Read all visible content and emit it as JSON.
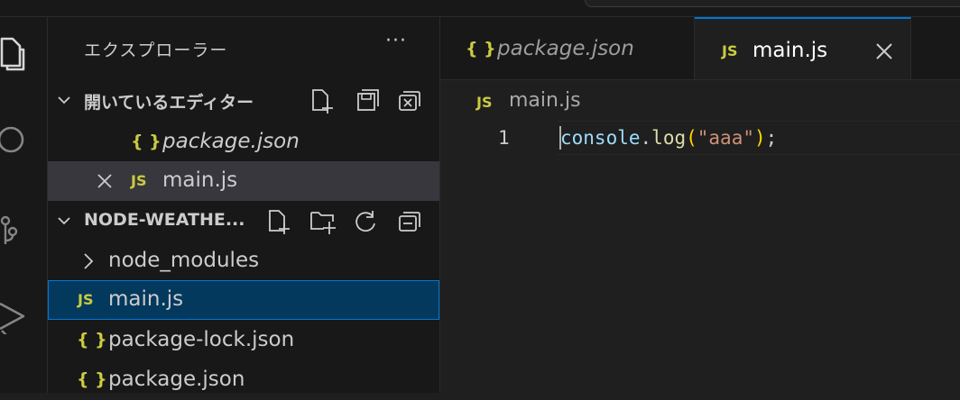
{
  "explorer": {
    "title": "エクスプローラー",
    "more_label": "···"
  },
  "open_editors": {
    "header": "開いているエディター",
    "items": [
      {
        "icon": "{ }",
        "label": "package.json"
      },
      {
        "icon": "JS",
        "label": "main.js"
      }
    ]
  },
  "project": {
    "header": "NODE-WEATHE...",
    "items": [
      {
        "icon": "›",
        "label": "node_modules"
      },
      {
        "icon": "JS",
        "label": "main.js"
      },
      {
        "icon": "{ }",
        "label": "package-lock.json"
      },
      {
        "icon": "{ }",
        "label": "package.json"
      }
    ]
  },
  "tabs": [
    {
      "icon": "{ }",
      "label": "package.json"
    },
    {
      "icon": "JS",
      "label": "main.js"
    }
  ],
  "breadcrumb": {
    "icon": "JS",
    "label": "main.js"
  },
  "code": {
    "line_number": "1",
    "tokens": {
      "object": "console",
      "dot": ".",
      "method": "log",
      "open_paren": "(",
      "string": "\"aaa\"",
      "close_paren": ")",
      "semicolon": ";"
    }
  },
  "colors": {
    "accent": "#0078d4",
    "js_icon": "#cbcb41",
    "selection": "#04395e"
  }
}
